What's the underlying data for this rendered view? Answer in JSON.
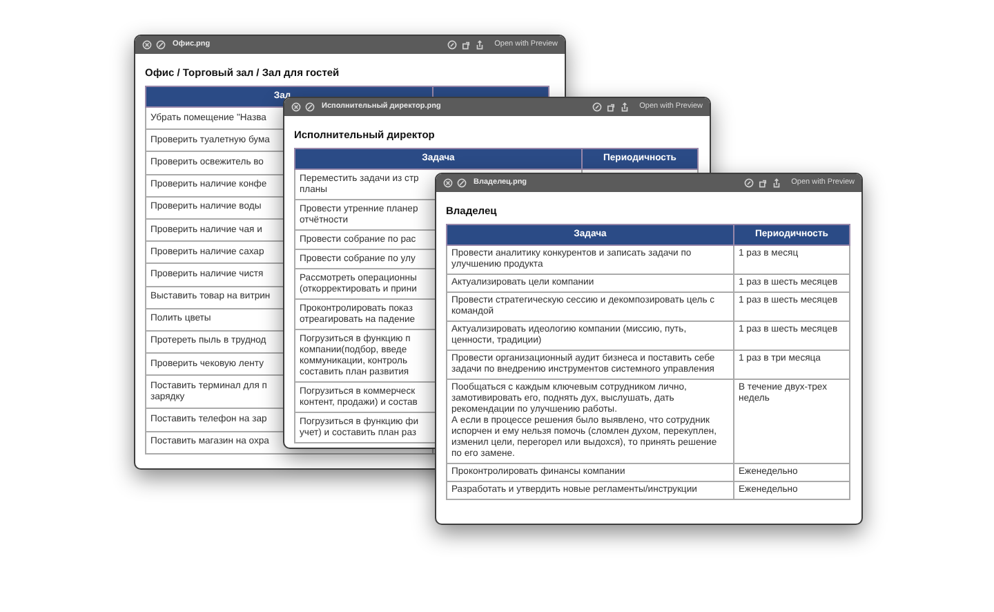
{
  "windows": [
    {
      "title": "Офис.png",
      "action": "Open with Preview",
      "heading": "Офис / Торговый зал / Зал для гостей",
      "columns": [
        "Зад"
      ],
      "rows": [
        {
          "task": "Убрать помещение \"Назва"
        },
        {
          "task": "Проверить туалетную бума"
        },
        {
          "task": "Проверить освежитель во"
        },
        {
          "task": "Проверить наличие конфе"
        },
        {
          "task": "Проверить наличие воды"
        },
        {
          "task": "Проверить наличие чая и"
        },
        {
          "task": "Проверить наличие сахар"
        },
        {
          "task": "Проверить наличие чистя"
        },
        {
          "task": "Выставить товар на витрин"
        },
        {
          "task": "Полить цветы"
        },
        {
          "task": "Протереть пыль в труднод"
        },
        {
          "task": "Проверить чековую ленту"
        },
        {
          "task": "Поставить терминал для п\nзарядку"
        },
        {
          "task": "Поставить телефон на зар"
        },
        {
          "task": "Поставить магазин на охра"
        }
      ]
    },
    {
      "title": "Исполнительный директор.png",
      "action": "Open with Preview",
      "heading": "Исполнительный директор",
      "columns": [
        "Задача",
        "Периодичность"
      ],
      "rows": [
        {
          "task": "Переместить задачи из стр\nпланы\n "
        },
        {
          "task": "Провести утренние планер\nотчётности"
        },
        {
          "task": "Провести собрание по рас"
        },
        {
          "task": "Провести собрание по улу"
        },
        {
          "task": "Рассмотреть операционны\n(откорректировать и прини"
        },
        {
          "task": "Проконтролировать показ\nотреагировать на падение"
        },
        {
          "task": "Погрузиться в функцию п\nкомпании(подбор, введе\nкоммуникации, контроль\nсоставить план развития"
        },
        {
          "task": "Погрузиться в коммерческ\nконтент, продажи) и состав"
        },
        {
          "task": "Погрузиться в функцию фи\nучет) и составить план раз"
        }
      ]
    },
    {
      "title": "Владелец.png",
      "action": "Open with Preview",
      "heading": "Владелец",
      "columns": [
        "Задача",
        "Периодичность"
      ],
      "rows": [
        {
          "task": "Провести аналитику конкурентов и записать задачи по улучшению продукта",
          "period": "1 раз в месяц"
        },
        {
          "task": "Актуализировать цели компании",
          "period": "1 раз в шесть месяцев"
        },
        {
          "task": "Провести стратегическую сессию и декомпозировать цель с командой",
          "period": "1 раз в шесть месяцев"
        },
        {
          "task": "Актуализировать идеологию компании (миссию, путь, ценности, традиции)",
          "period": "1 раз в шесть месяцев"
        },
        {
          "task": "Провести организационный аудит бизнеса и поставить себе задачи по внедрению инструментов системного управления",
          "period": "1 раз в три месяца"
        },
        {
          "task": "Пообщаться с каждым ключевым сотрудником лично, замотивировать его, поднять дух, выслушать, дать рекомендации по улучшению работы.\nА если в процессе решения было выявлено, что сотрудник испорчен и ему нельзя помочь (сломлен духом, перекуплен, изменил цели, перегорел или выдохся), то принять решение по его замене.",
          "period": "В течение двух-трех недель"
        },
        {
          "task": "Проконтролировать финансы компании",
          "period": "Еженедельно"
        },
        {
          "task": "Разработать и утвердить новые регламенты/инструкции",
          "period": "Еженедельно"
        }
      ]
    }
  ]
}
